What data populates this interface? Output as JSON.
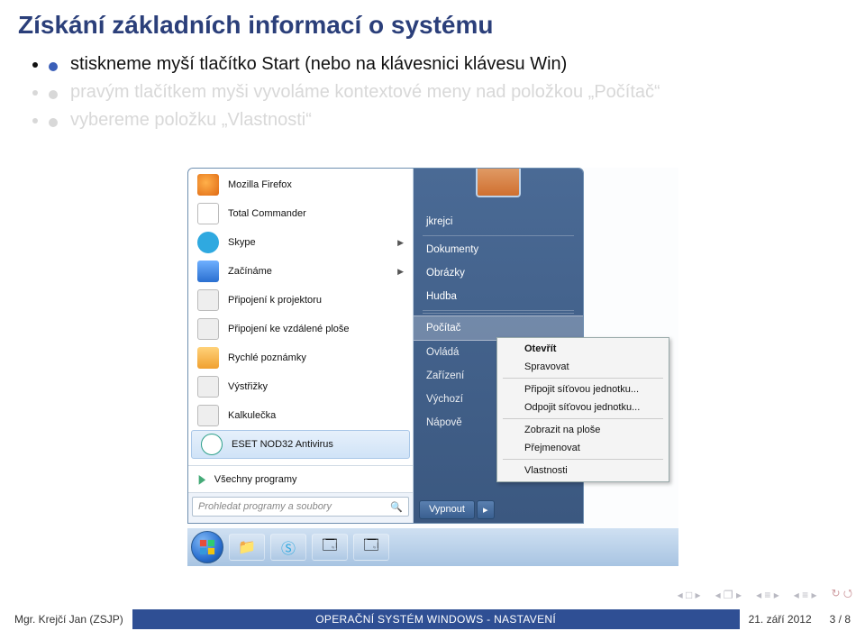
{
  "title": "Získání základních informací o systému",
  "bullets": [
    {
      "text": "stiskneme myší tlačítko Start (nebo na klávesnici klávesu Win)",
      "dim": false
    },
    {
      "text": "pravým tlačítkem myši vyvoláme kontextové meny nad položkou „Počítač“",
      "dim": true
    },
    {
      "text": "vybereme položku „Vlastnosti“",
      "dim": true
    }
  ],
  "startmenu": {
    "left_items": [
      {
        "label": "Mozilla Firefox",
        "icon": "ico-ff"
      },
      {
        "label": "Total Commander",
        "icon": "ico-tc"
      },
      {
        "label": "Skype",
        "icon": "ico-skype",
        "expand": true
      },
      {
        "label": "Začínáme",
        "icon": "ico-start",
        "expand": true
      },
      {
        "label": "Připojení k projektoru",
        "icon": "ico-proj"
      },
      {
        "label": "Připojení ke vzdálené ploše",
        "icon": "ico-remote"
      },
      {
        "label": "Rychlé poznámky",
        "icon": "ico-notes"
      },
      {
        "label": "Výstřižky",
        "icon": "ico-snip"
      },
      {
        "label": "Kalkulečka",
        "icon": "ico-calc"
      },
      {
        "label": "ESET NOD32 Antivirus",
        "icon": "ico-eset",
        "highlight": true
      }
    ],
    "all_programs": "Všechny programy",
    "search_placeholder": "Prohledat programy a soubory",
    "right_items": [
      {
        "label": "jkrejci"
      },
      {
        "label": "Dokumenty"
      },
      {
        "label": "Obrázky"
      },
      {
        "label": "Hudba"
      },
      {
        "label": "Počítač",
        "selected": true
      },
      {
        "label": "Ovládá",
        "cut": true
      },
      {
        "label": "Zařízení",
        "cut": true
      },
      {
        "label": "Výchozí",
        "cut": true
      },
      {
        "label": "Nápově",
        "cut": true
      }
    ],
    "shutdown": "Vypnout",
    "shutdown_arrow": "▸"
  },
  "context_menu": [
    {
      "label": "Otevřít",
      "bold": true
    },
    {
      "label": "Spravovat"
    },
    {
      "sep": true
    },
    {
      "label": "Připojit síťovou jednotku..."
    },
    {
      "label": "Odpojit síťovou jednotku..."
    },
    {
      "sep": true
    },
    {
      "label": "Zobrazit na ploše"
    },
    {
      "label": "Přejmenovat"
    },
    {
      "sep": true
    },
    {
      "label": "Vlastnosti"
    }
  ],
  "footer": {
    "left": "Mgr. Krejčí Jan (ZSJP)",
    "center": "OPERAČNÍ SYSTÉM WINDOWS - NASTAVENÍ",
    "right": "21. září 2012",
    "page": "3 / 8"
  }
}
